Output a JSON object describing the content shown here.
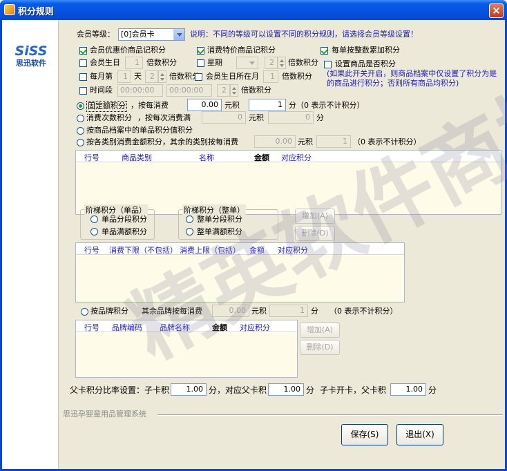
{
  "window": {
    "title": "积分规则",
    "close": "×"
  },
  "logo": {
    "brand": "SiSS",
    "sub": "思迅软件"
  },
  "member_level": {
    "label": "会员等级：",
    "value": "[0]会员卡",
    "note": "说明：不同的等级可以设置不同的积分规则，请选择会员等级设置！"
  },
  "options": {
    "discount_goods": "会员优惠价商品记积分",
    "special_goods": "消费特价商品记积分",
    "round_per_order": "每单按整数累加积分",
    "birthday_label": "会员生日",
    "birthday_days": "1",
    "birthday_mult": "倍数积分",
    "week_label": "星期",
    "week_mult_value": "2",
    "week_mult": "倍数积分",
    "goods_point_flag": "设置商品是否积分",
    "goods_point_note": "(如果此开关开启，则商品档案中仅设置了积分为是的商品进行积分；否则所有商品均积分)",
    "monthly_label": "每月第",
    "monthly_day": "1",
    "monthly_day_unit": "天",
    "monthly_mult_value": "2",
    "monthly_mult": "倍数积分",
    "birth_month_label": "会员生日所在月",
    "birth_month_value": "1",
    "birth_month_mult": "倍数积分",
    "period_label": "时间段",
    "period_start": "00:00:00",
    "period_end": "00:00:00",
    "period_mult_value": "2",
    "period_mult": "倍数积分"
  },
  "rules": {
    "fixed": {
      "label": "固定额积分",
      "text1": "，按每消费",
      "amount": "0.00",
      "unit": "元积",
      "points": "1",
      "text2": "分（0 表示不计积分）"
    },
    "count": {
      "label": "消费次数积分",
      "text1": "，按每次消费满",
      "amount": "0",
      "unit": "元积",
      "points": "0",
      "text2": "分"
    },
    "goods_value": {
      "label": "按商品档案中的单品积分值积分"
    },
    "category": {
      "label": "按各类别消费金额积分，其余的类别按每消费",
      "amount": "0.00",
      "unit": "元积",
      "points": "1",
      "text2": "（0 表示不计积分）"
    }
  },
  "grid1": {
    "cols": [
      "行号",
      "商品类别",
      "名称",
      "金额",
      "对应积分"
    ]
  },
  "tier_single": {
    "title": "阶梯积分（单品）",
    "opt1": "单品分段积分",
    "opt2": "单品满额积分"
  },
  "tier_order": {
    "title": "阶梯积分（整单）",
    "opt1": "整单分段积分",
    "opt2": "整单满额积分"
  },
  "tier_buttons": {
    "add": "增加(A)",
    "delete": "删除(D)"
  },
  "grid2": {
    "cols": [
      "行号",
      "消费下限（不包括）",
      "消费上限（包括）",
      "金额",
      "对应积分"
    ]
  },
  "brand": {
    "label": "按品牌积分",
    "text1": "其余品牌按每消费",
    "amount": "0.00",
    "unit": "元积",
    "points": "1",
    "text2": "分",
    "note": "（0  表示不计积分）"
  },
  "grid3": {
    "cols": [
      "行号",
      "品牌编码",
      "品牌名称",
      "金额",
      "对应积分"
    ]
  },
  "brand_buttons": {
    "add": "增加(A)",
    "delete": "删除(D)"
  },
  "parent_card": {
    "label": "父卡积分比率设置：子卡积",
    "v1": "1.00",
    "t1": "分，对应父卡积",
    "v2": "1.00",
    "t2": "分",
    "t3": "子卡开卡，父卡积",
    "v3": "1.00",
    "t4": "分"
  },
  "footer": {
    "system": "思迅孕婴童用品管理系统",
    "save": "保存(S)",
    "exit": "退出(X)"
  },
  "watermark": "精英软件商城"
}
